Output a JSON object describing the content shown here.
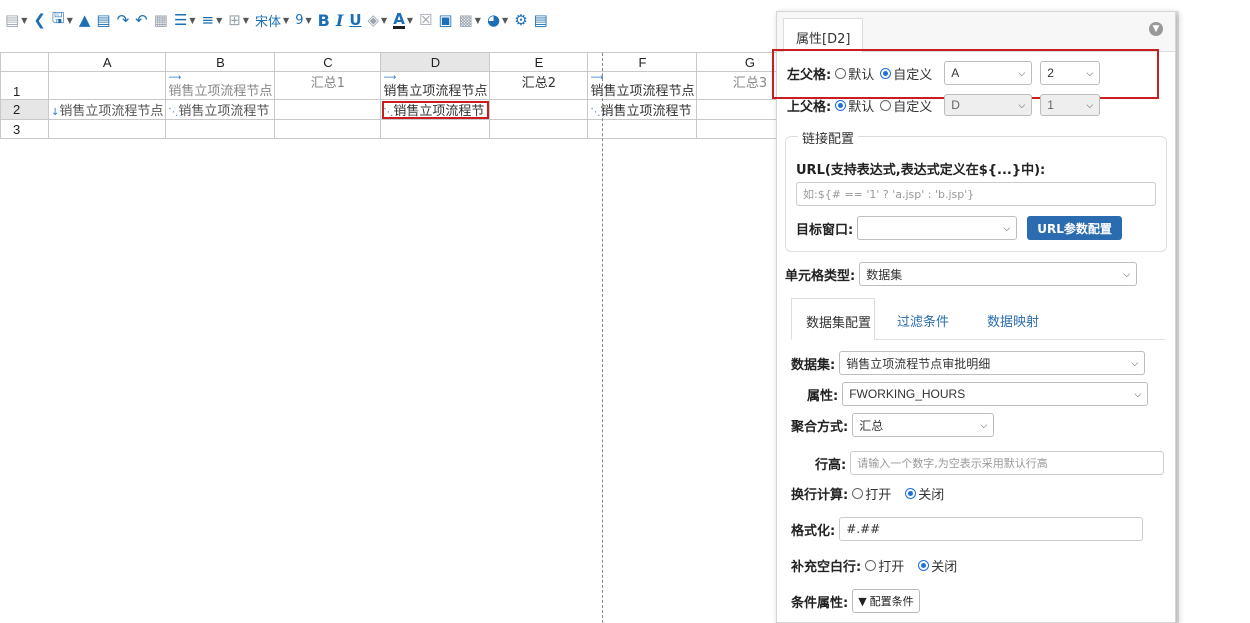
{
  "toolbar": {
    "font_name": "宋体",
    "font_size": "9",
    "bold": "B",
    "italic": "I",
    "underline": "U",
    "font_color": "A"
  },
  "grid": {
    "columns": [
      "A",
      "B",
      "C",
      "D",
      "E",
      "F",
      "G"
    ],
    "rows": [
      {
        "num": "1",
        "cells": [
          "",
          "销售立项流程节点",
          "汇总1",
          "销售立项流程节点",
          "汇总2",
          "销售立项流程节点",
          "汇总3"
        ]
      },
      {
        "num": "2",
        "cells": [
          "销售立项流程节点",
          "销售立项流程节",
          "",
          "销售立项流程节",
          "",
          "销售立项流程节",
          ""
        ]
      },
      {
        "num": "3",
        "cells": [
          "",
          "",
          "",
          "",
          "",
          "",
          ""
        ]
      }
    ],
    "selected_column": "D",
    "selected_row": "2"
  },
  "panel": {
    "tab": "属性[D2]",
    "left_parent": {
      "label": "左父格:",
      "opt_default": "默认",
      "opt_custom": "自定义",
      "selected": "custom",
      "col": "A",
      "row": "2"
    },
    "top_parent": {
      "label": "上父格:",
      "opt_default": "默认",
      "opt_custom": "自定义",
      "selected": "default",
      "col": "D",
      "row": "1"
    },
    "link": {
      "legend": "链接配置",
      "url_label": "URL(支持表达式,表达式定义在${...}中):",
      "url_placeholder": "如:${# == '1' ? 'a.jsp' : 'b.jsp'}",
      "target_label": "目标窗口:",
      "target_value": "",
      "param_button": "URL参数配置"
    },
    "cell_type": {
      "label": "单元格类型:",
      "value": "数据集"
    },
    "tabs": [
      "数据集配置",
      "过滤条件",
      "数据映射"
    ],
    "active_tab": 0,
    "dataset": {
      "label": "数据集:",
      "value": "销售立项流程节点审批明细"
    },
    "attribute": {
      "label": "属性:",
      "value": "FWORKING_HOURS"
    },
    "aggregate": {
      "label": "聚合方式:",
      "value": "汇总"
    },
    "row_height": {
      "label": "行高:",
      "placeholder": "请输入一个数字,为空表示采用默认行高"
    },
    "wrap_calc": {
      "label": "换行计算:",
      "opt_on": "打开",
      "opt_off": "关闭",
      "selected": "off"
    },
    "format": {
      "label": "格式化:",
      "value": "#.##"
    },
    "fill_blank": {
      "label": "补充空白行:",
      "opt_on": "打开",
      "opt_off": "关闭",
      "selected": "off"
    },
    "condition": {
      "label": "条件属性:",
      "button": "配置条件"
    }
  }
}
